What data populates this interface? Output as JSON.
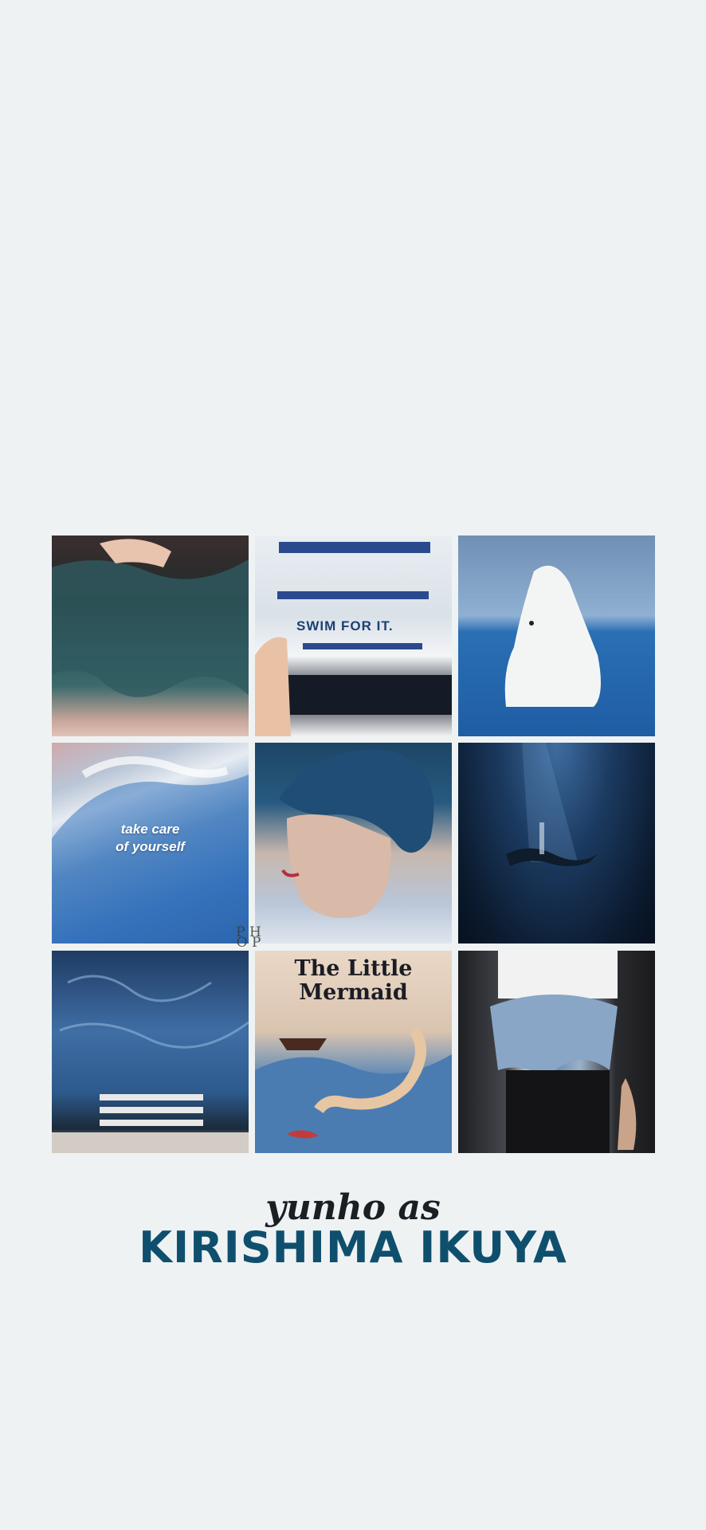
{
  "collage": {
    "tiles": [
      {
        "subject": "teal dyed hair"
      },
      {
        "subject": "swim pool stand",
        "text": "SWIM FOR IT."
      },
      {
        "subject": "beluga whale"
      },
      {
        "subject": "blue wave",
        "text": "take care\nof yourself"
      },
      {
        "subject": "portrait blue hair"
      },
      {
        "subject": "underwater diver"
      },
      {
        "subject": "pool ladder water"
      },
      {
        "subject": "book cover",
        "text": "The Little\nMermaid"
      },
      {
        "subject": "denim jacket"
      }
    ]
  },
  "caption": {
    "subtitle": "yunho as",
    "title": "KIRISHIMA IKUYA"
  },
  "watermark": "P H O P"
}
